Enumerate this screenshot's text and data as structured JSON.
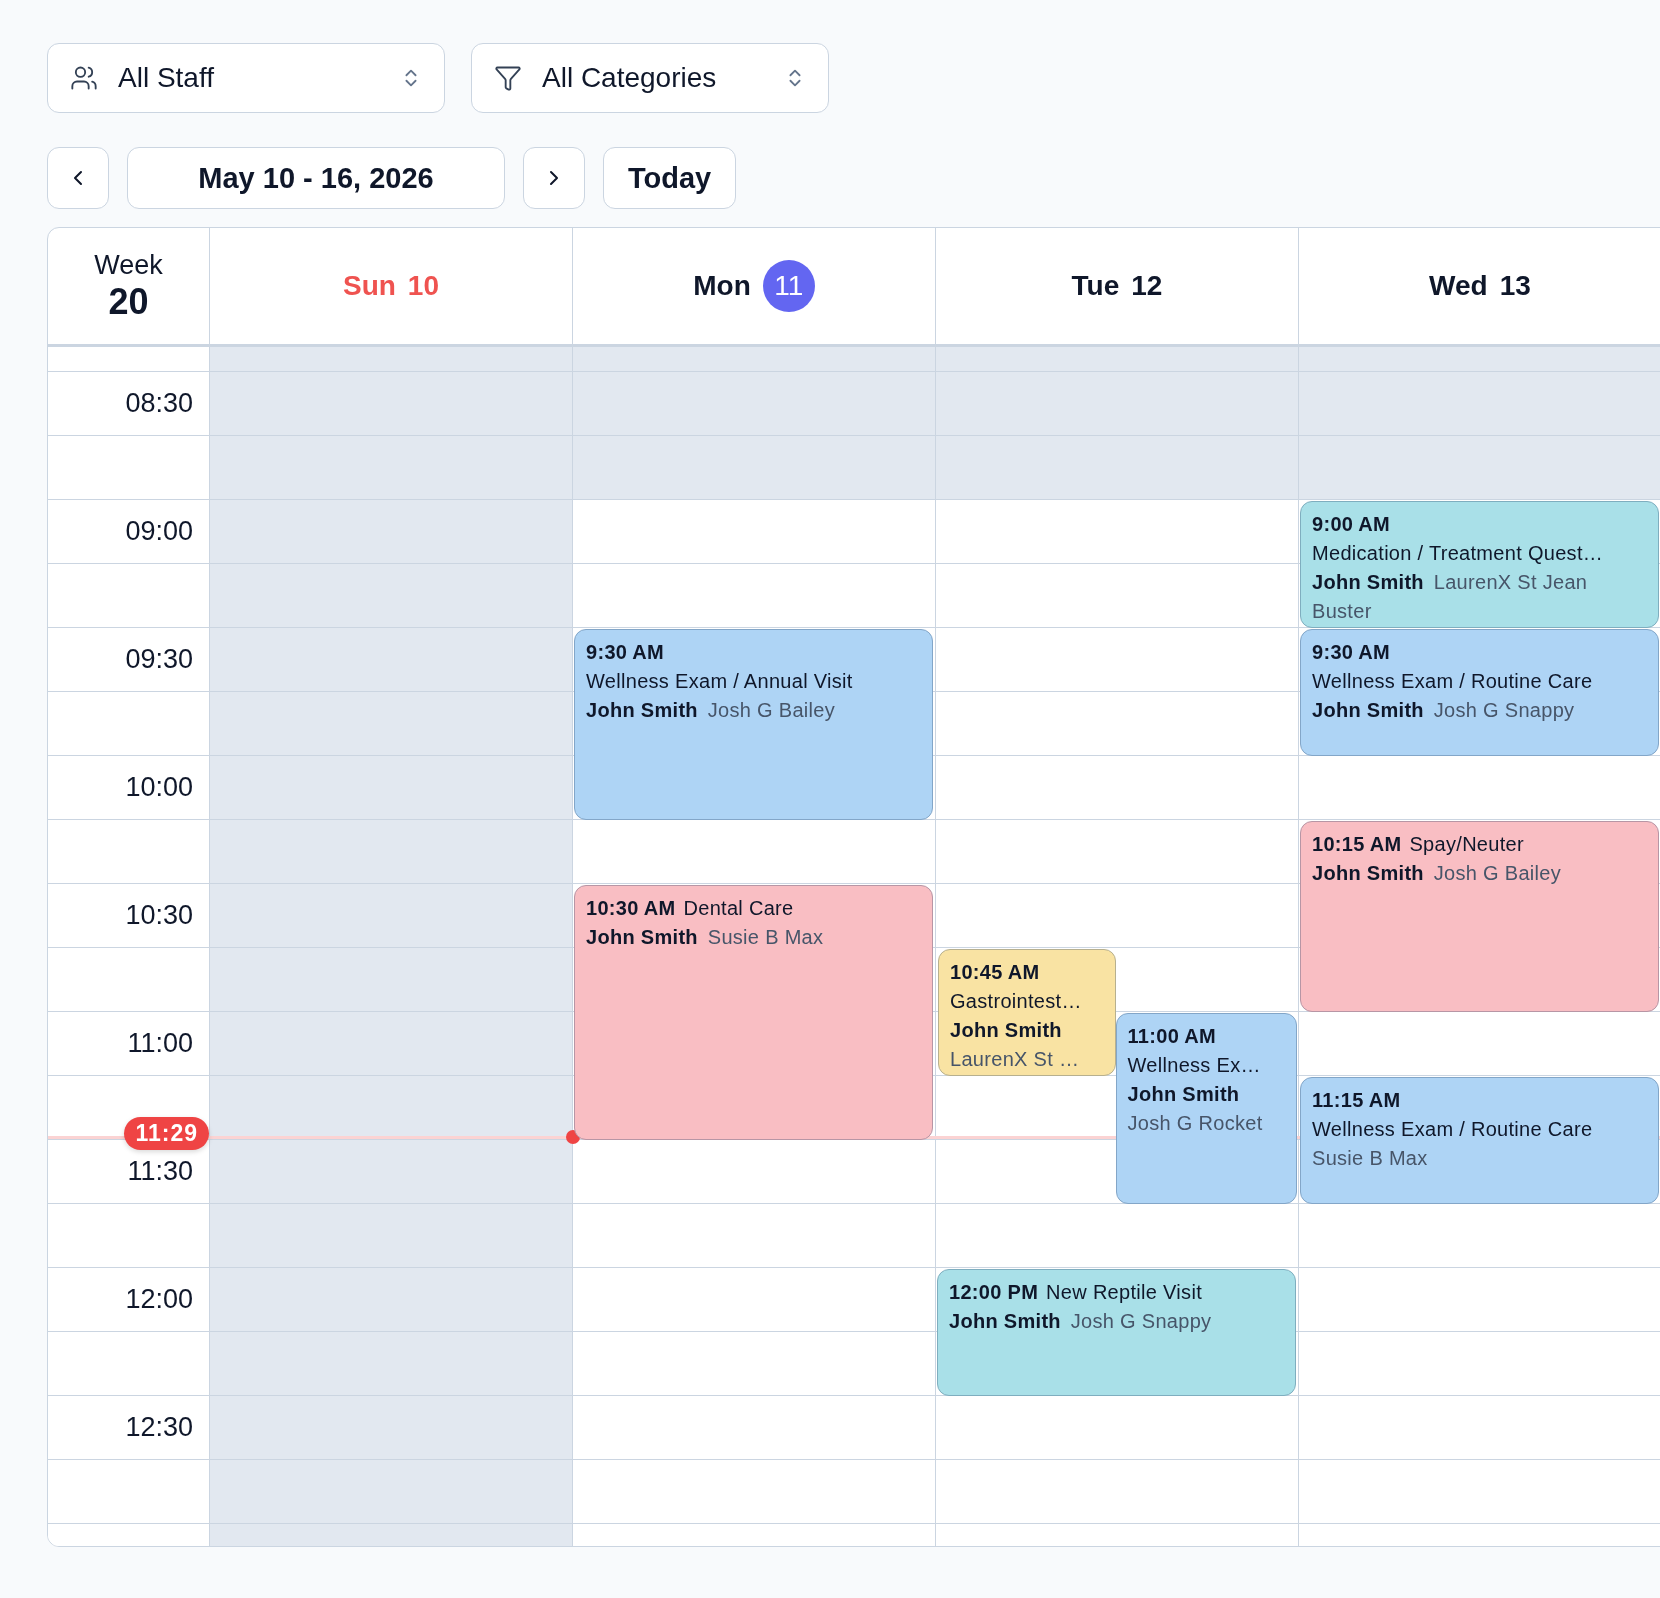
{
  "filters": [
    {
      "kind": "staff",
      "label": "All Staff"
    },
    {
      "kind": "category",
      "label": "All Categories"
    }
  ],
  "navigation": {
    "range": "May 10 - 16, 2026",
    "today_button": "Today"
  },
  "week": {
    "label": "Week",
    "number": "20"
  },
  "rows": [
    {
      "label": "08:30",
      "open": false
    },
    {
      "label": "09:00",
      "open": true
    },
    {
      "label": "09:30",
      "open": true
    },
    {
      "label": "10:00",
      "open": true
    },
    {
      "label": "10:30",
      "open": true
    },
    {
      "label": "11:00",
      "open": true
    },
    {
      "label": "11:30",
      "open": true
    },
    {
      "label": "12:00",
      "open": true
    },
    {
      "label": "12:30",
      "open": true
    }
  ],
  "now": {
    "label": "11:29"
  },
  "days": [
    {
      "name": "Sun",
      "date": "10",
      "weekend": true,
      "today": false,
      "closed": true
    },
    {
      "name": "Mon",
      "date": "11",
      "weekend": false,
      "today": true,
      "closed": false,
      "events": [
        {
          "kind": "medium",
          "time": "9:30 AM",
          "title": "Wellness Exam / Annual Visit",
          "title_inline": false,
          "client": "John Smith",
          "patient": "Josh G Bailey",
          "color": "#aed4f5"
        },
        {
          "kind": "long",
          "time": "10:30 AM",
          "title": "Dental Care",
          "title_inline": true,
          "client": "John Smith",
          "patient": "Susie B Max",
          "color": "#f9bec3"
        }
      ]
    },
    {
      "name": "Tue",
      "date": "12",
      "weekend": false,
      "today": false,
      "closed": false,
      "events": [
        {
          "kind": "short",
          "time": "10:45 AM",
          "title": "Gastrointest…",
          "title_inline": false,
          "client": "John Smith",
          "patient": "LaurenX St …",
          "color": "#f9e3a3"
        },
        {
          "kind": "medium",
          "time": "11:00 AM",
          "title": "Wellness Ex…",
          "title_inline": false,
          "client": "John Smith",
          "patient": "Josh G Rocket",
          "color": "#aed4f5"
        },
        {
          "kind": "short",
          "time": "12:00 PM",
          "title": "New Reptile Visit",
          "title_inline": true,
          "client": "John Smith",
          "patient": "Josh G Snappy",
          "color": "#a9e0e8"
        }
      ]
    },
    {
      "name": "Wed",
      "date": "13",
      "weekend": false,
      "today": false,
      "closed": false,
      "events": [
        {
          "kind": "short",
          "time": "9:00 AM",
          "title": "Medication / Treatment Quest…",
          "title_inline": false,
          "client": "John Smith",
          "patient": "LaurenX St Jean Buster",
          "color": "#a9e0e8"
        },
        {
          "kind": "short",
          "time": "9:30 AM",
          "title": "Wellness Exam / Routine Care",
          "title_inline": false,
          "client": "John Smith",
          "patient": "Josh G Snappy",
          "color": "#aed4f5"
        },
        {
          "kind": "medium",
          "time": "10:15 AM",
          "title": "Spay/Neuter",
          "title_inline": true,
          "client": "John Smith",
          "patient": "Josh G Bailey",
          "color": "#f9bec3"
        },
        {
          "kind": "short",
          "time": "11:15 AM",
          "title": "Wellness Exam / Routine Care",
          "title_inline": false,
          "patient": "Susie B Max",
          "color": "#aed4f5"
        }
      ]
    }
  ]
}
